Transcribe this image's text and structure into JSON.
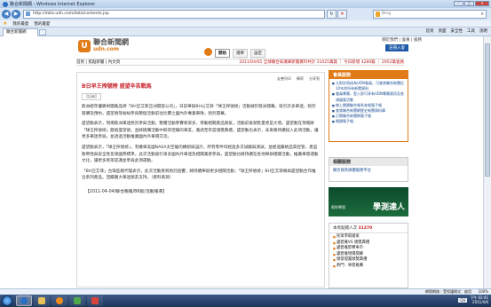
{
  "browser": {
    "title": "聯合新聞網 - Windows Internet Explorer",
    "url": "http://data.udn.com/data/contents.jsp",
    "search_placeholder": "Bing",
    "favorites": [
      "我的最愛",
      "我的最愛"
    ],
    "tab_label": "聯合新聞網",
    "commands": [
      "首頁",
      "頁面",
      "安全性",
      "工具",
      "說明"
    ]
  },
  "site": {
    "logo_name": "聯合新聞網",
    "logo_domain": "udn.com",
    "top_links": "關於我們 | 會員 | 服務",
    "nav_tabs": [
      "開始",
      "選單",
      "設定"
    ],
    "login_label": "註冊入會",
    "breadcrumb": "首頁 | 焦點新聞 | 內文頁",
    "ticker": "2011/04/05 全球聯合知識庫新聞資料共計 11025萬篇 ｜ 今日新增 4280篇 ｜ 2952萬會員"
  },
  "article": {
    "tools": [
      "友善列印",
      "轉寄",
      "分享到"
    ],
    "headline": "B日早王搾號榜 盛望辛苦戰馬",
    "byline": "【記者】",
    "paragraphs": [
      "歐洲經年優勝財團集品牌「BH亞艾菲亞洲開發公司」，日前舉辦BH公艾菲「球王搾號榜」活動據於歐洲開幕，吸引許多車迷，熱烈搶購及預約，盛望號等紛紛參與整個活動前往比賽之國內外專業車隊，熱烈開幕。",
      "盛望動表示，現場歐洲車迷熱烈參與活動，整體活動參賽者眾多，帶動相關產品買氣，活動前後銷售量更是大增。盛望動在現場將「球王搾號榜」獻給盛望號，並將搶購活動中取得佳績的車友，邀請至年度頒獎典禮。盛望動也表示，未來將持續投入此項活動，讓更多車迷參與，並透過活動推廣國內外車壇交流。",
      "盛望動表示，「球王搾號榜」，有機車美國NASA太空艙的構想與設計，所有零件均經過多次試驗與測試，並經過嚴格品質控管，產品耐用性與安全性皆達國際標準。此次活動吸引眾多國內外車迷及相關業者參與，盛望動也將持續在各地舉辦相關活動，推廣車壇運動文化，讓更多民眾認識並參與此項運動。",
      "「BH亞艾菲」台灣區總代理表示，此次活動受到熱烈迴響，將持續舉辦更多相關活動；「球王搾號榜」BH亞艾菲將與盛望動合作推出系列產品，回饋廣大車迷朋友支持。（資料來源）"
    ],
    "dateline": "【2011-04-04/聯合晚報/B6版/活動報導】"
  },
  "sidebar": {
    "member_title": "會員服務",
    "member_items": [
      "立即註冊成為UDN會員，可查詢聯合新聞近10年的所有新聞資料",
      "會員專屬，登入即可享有UDN專屬資訊及各項優惠活動",
      "線上閱讀聯合報系各報電子報",
      "查詢聯合新聞網歷史新聞資料庫",
      "訂閱聯合新聞網電子報",
      "閱讀電子報"
    ],
    "related_title": "相關服務",
    "related_item": "聯合報系媒體服務平台",
    "banner_small": "幫你學習",
    "banner_text": "學測達人",
    "news_header_prefix": "本頁點閱人次",
    "news_count": "31370",
    "news_items": [
      "民眾爭取國家",
      "盧碧雅VS 頒獎典禮",
      "盧碧雅影響車市",
      "盧碧雅現場開幕",
      "頒發證書頒獎典禮",
      "熱門：車壇推薦"
    ]
  },
  "status": {
    "zone": "網際網路｜受保護模式：啟用",
    "zoom": "100%"
  },
  "taskbar": {
    "lang": "CH",
    "time": "下午 02:41",
    "date": "2011/4/6"
  }
}
